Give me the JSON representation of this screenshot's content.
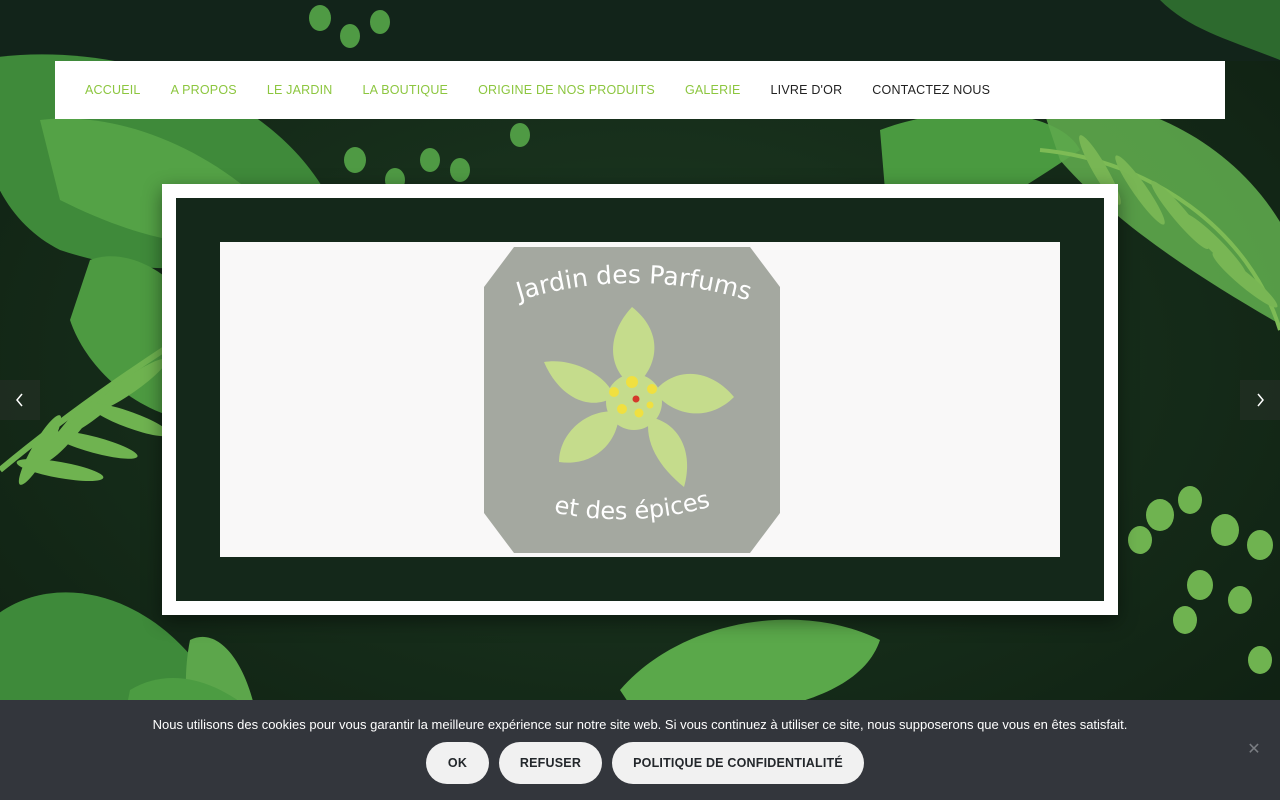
{
  "nav": {
    "items": [
      {
        "label": "ACCUEIL",
        "color": "#8cc63f"
      },
      {
        "label": "A PROPOS",
        "color": "#8cc63f"
      },
      {
        "label": "LE JARDIN",
        "color": "#8cc63f"
      },
      {
        "label": "LA BOUTIQUE",
        "color": "#8cc63f"
      },
      {
        "label": "ORIGINE DE NOS PRODUITS",
        "color": "#8cc63f"
      },
      {
        "label": "GALERIE",
        "color": "#8cc63f"
      },
      {
        "label": "LIVRE D'OR",
        "color": "#222222"
      },
      {
        "label": "CONTACTEZ NOUS",
        "color": "#222222"
      }
    ]
  },
  "slider": {
    "prev_icon": "chevron-left-icon",
    "next_icon": "chevron-right-icon"
  },
  "logo": {
    "top_text": "Jardin des Parfums",
    "bottom_text": "et des épices",
    "badge_color": "#a4a8a0",
    "petal_color": "#c5dc8c"
  },
  "cookie": {
    "message": "Nous utilisons des cookies pour vous garantir la meilleure expérience sur notre site web. Si vous continuez à utiliser ce site, nous supposerons que vous en êtes satisfait.",
    "ok_label": "OK",
    "refuse_label": "REFUSER",
    "privacy_label": "POLITIQUE DE CONFIDENTIALITÉ",
    "close_icon": "close-icon"
  },
  "colors": {
    "accent": "#8cc63f",
    "cookie_bg": "#33363c",
    "background": "#17301a"
  }
}
